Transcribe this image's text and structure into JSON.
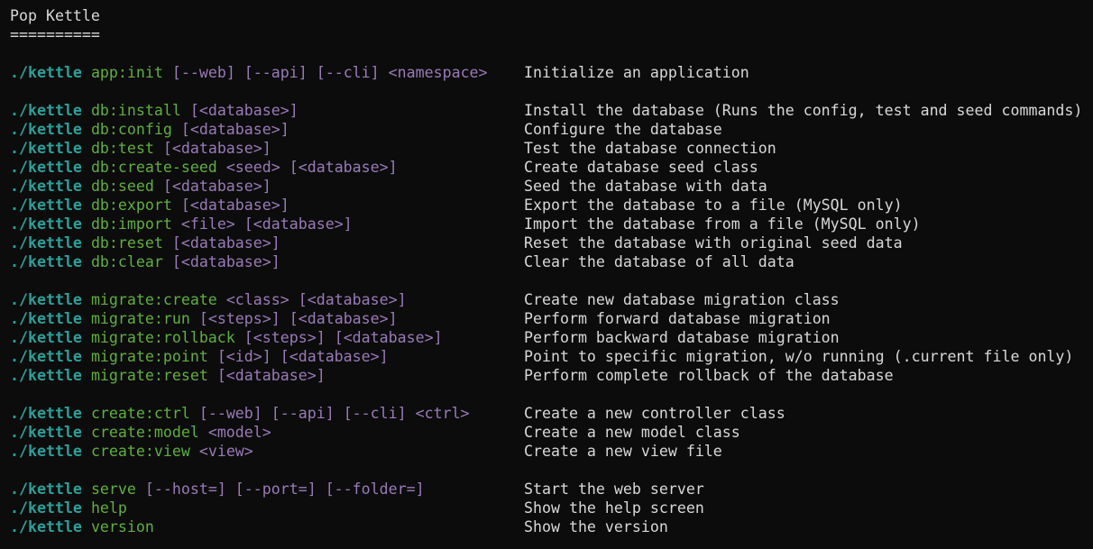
{
  "title": "Pop Kettle",
  "underline": "==========",
  "colors": {
    "background": "#0c0c0c",
    "text": "#d8d8d8",
    "executable": "#2aa198",
    "subcommand": "#5faf3c",
    "args": "#9a7ab8"
  },
  "groups": [
    {
      "commands": [
        {
          "exe": "./kettle",
          "sub": "app:init",
          "args": "[--web] [--api] [--cli] <namespace>",
          "desc": "Initialize an application"
        }
      ]
    },
    {
      "commands": [
        {
          "exe": "./kettle",
          "sub": "db:install",
          "args": "[<database>]",
          "desc": "Install the database (Runs the config, test and seed commands)"
        },
        {
          "exe": "./kettle",
          "sub": "db:config",
          "args": "[<database>]",
          "desc": "Configure the database"
        },
        {
          "exe": "./kettle",
          "sub": "db:test",
          "args": "[<database>]",
          "desc": "Test the database connection"
        },
        {
          "exe": "./kettle",
          "sub": "db:create-seed",
          "args": "<seed> [<database>]",
          "desc": "Create database seed class"
        },
        {
          "exe": "./kettle",
          "sub": "db:seed",
          "args": "[<database>]",
          "desc": "Seed the database with data"
        },
        {
          "exe": "./kettle",
          "sub": "db:export",
          "args": "[<database>]",
          "desc": "Export the database to a file (MySQL only)"
        },
        {
          "exe": "./kettle",
          "sub": "db:import",
          "args": "<file> [<database>]",
          "desc": "Import the database from a file (MySQL only)"
        },
        {
          "exe": "./kettle",
          "sub": "db:reset",
          "args": "[<database>]",
          "desc": "Reset the database with original seed data"
        },
        {
          "exe": "./kettle",
          "sub": "db:clear",
          "args": "[<database>]",
          "desc": "Clear the database of all data"
        }
      ]
    },
    {
      "commands": [
        {
          "exe": "./kettle",
          "sub": "migrate:create",
          "args": "<class> [<database>]",
          "desc": "Create new database migration class"
        },
        {
          "exe": "./kettle",
          "sub": "migrate:run",
          "args": "[<steps>] [<database>]",
          "desc": "Perform forward database migration"
        },
        {
          "exe": "./kettle",
          "sub": "migrate:rollback",
          "args": "[<steps>] [<database>]",
          "desc": "Perform backward database migration"
        },
        {
          "exe": "./kettle",
          "sub": "migrate:point",
          "args": "[<id>] [<database>]",
          "desc": "Point to specific migration, w/o running (.current file only)"
        },
        {
          "exe": "./kettle",
          "sub": "migrate:reset",
          "args": "[<database>]",
          "desc": "Perform complete rollback of the database"
        }
      ]
    },
    {
      "commands": [
        {
          "exe": "./kettle",
          "sub": "create:ctrl",
          "args": "[--web] [--api] [--cli] <ctrl>",
          "desc": "Create a new controller class"
        },
        {
          "exe": "./kettle",
          "sub": "create:model",
          "args": "<model>",
          "desc": "Create a new model class"
        },
        {
          "exe": "./kettle",
          "sub": "create:view",
          "args": "<view>",
          "desc": "Create a new view file"
        }
      ]
    },
    {
      "commands": [
        {
          "exe": "./kettle",
          "sub": "serve",
          "args": "[--host=] [--port=] [--folder=]",
          "desc": "Start the web server"
        },
        {
          "exe": "./kettle",
          "sub": "help",
          "args": "",
          "desc": "Show the help screen"
        },
        {
          "exe": "./kettle",
          "sub": "version",
          "args": "",
          "desc": "Show the version"
        }
      ]
    }
  ]
}
